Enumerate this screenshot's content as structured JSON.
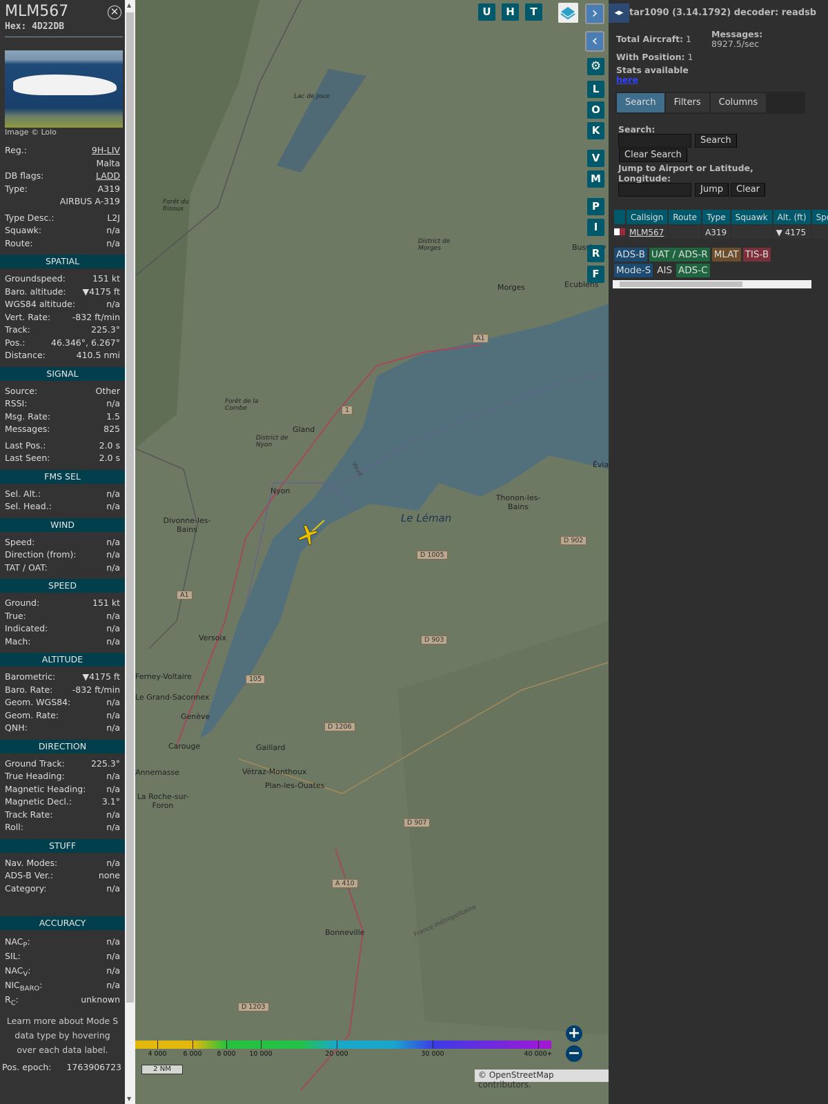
{
  "detail": {
    "callsign": "MLM567",
    "hex": "Hex: 4D22DB",
    "image_credit": "Image © Lolo",
    "top_rows": [
      {
        "label": "Reg.:",
        "value": "9H-LIV",
        "link": true
      },
      {
        "label": "",
        "value": "Malta"
      },
      {
        "label": "DB flags:",
        "value": "LADD",
        "link": true
      },
      {
        "label": "Type:",
        "value": "A319"
      },
      {
        "label": "",
        "value": "AIRBUS A-319"
      },
      {
        "label": "Type Desc.:",
        "value": "L2J"
      },
      {
        "label": "Squawk:",
        "value": "n/a"
      },
      {
        "label": "Route:",
        "value": "n/a"
      }
    ],
    "sections": [
      {
        "title": "SPATIAL",
        "rows": [
          [
            "Groundspeed:",
            "151 kt"
          ],
          [
            "Baro. altitude:",
            "▼4175 ft"
          ],
          [
            "WGS84 altitude:",
            "n/a"
          ],
          [
            "Vert. Rate:",
            "-832 ft/min"
          ],
          [
            "Track:",
            "225.3°"
          ],
          [
            "Pos.:",
            "46.346°, 6.267°"
          ],
          [
            "Distance:",
            "410.5 nmi"
          ]
        ]
      },
      {
        "title": "SIGNAL",
        "rows": [
          [
            "Source:",
            "Other"
          ],
          [
            "RSSI:",
            "n/a"
          ],
          [
            "Msg. Rate:",
            "1.5"
          ],
          [
            "Messages:",
            "825"
          ],
          [
            "Last Pos.:",
            "2.0 s"
          ],
          [
            "Last Seen:",
            "2.0 s"
          ]
        ]
      },
      {
        "title": "FMS SEL",
        "rows": [
          [
            "Sel. Alt.:",
            "n/a"
          ],
          [
            "Sel. Head.:",
            "n/a"
          ]
        ]
      },
      {
        "title": "WIND",
        "rows": [
          [
            "Speed:",
            "n/a"
          ],
          [
            "Direction (from):",
            "n/a"
          ],
          [
            "TAT / OAT:",
            "n/a"
          ]
        ]
      },
      {
        "title": "SPEED",
        "rows": [
          [
            "Ground:",
            "151 kt"
          ],
          [
            "True:",
            "n/a"
          ],
          [
            "Indicated:",
            "n/a"
          ],
          [
            "Mach:",
            "n/a"
          ]
        ]
      },
      {
        "title": "ALTITUDE",
        "rows": [
          [
            "Barometric:",
            "▼4175 ft"
          ],
          [
            "Baro. Rate:",
            "-832 ft/min"
          ],
          [
            "Geom. WGS84:",
            "n/a"
          ],
          [
            "Geom. Rate:",
            "n/a"
          ],
          [
            "QNH:",
            "n/a"
          ]
        ]
      },
      {
        "title": "DIRECTION",
        "rows": [
          [
            "Ground Track:",
            "225.3°"
          ],
          [
            "True Heading:",
            "n/a"
          ],
          [
            "Magnetic Heading:",
            "n/a"
          ],
          [
            "Magnetic Decl.:",
            "3.1°"
          ],
          [
            "Track Rate:",
            "n/a"
          ],
          [
            "Roll:",
            "n/a"
          ]
        ]
      },
      {
        "title": "STUFF",
        "rows": [
          [
            "Nav. Modes:",
            "n/a"
          ],
          [
            "ADS-B Ver.:",
            "none"
          ],
          [
            "Category:",
            "n/a"
          ]
        ]
      }
    ],
    "accuracy": {
      "title": "ACCURACY",
      "rows": [
        {
          "label": "NAC",
          "sub": "P",
          "value": "n/a"
        },
        {
          "label": "SIL",
          "sub": "",
          "value": "n/a"
        },
        {
          "label": "NAC",
          "sub": "V",
          "value": "n/a"
        },
        {
          "label": "NIC",
          "sub": "BARO",
          "value": "n/a"
        },
        {
          "label": "R",
          "sub": "C",
          "value": "unknown"
        }
      ]
    },
    "learn_more": "Learn more about Mode S data type by hovering over each data label.",
    "pos_epoch_label": "Pos. epoch:",
    "pos_epoch": "1763906723"
  },
  "map": {
    "top_buttons": [
      "U",
      "H",
      "T"
    ],
    "side_buttons": [
      "L",
      "O",
      "K",
      "V",
      "M",
      "P",
      "I",
      "R",
      "F"
    ],
    "places": [
      "Lac de Joux",
      "Forêt du Risoux",
      "District de Morges",
      "Morges",
      "Bussigny",
      "Ecublens",
      "Forêt de la Combe",
      "Gland",
      "District de Nyon",
      "Nyon",
      "Divonne-les-Bains",
      "Le Léman",
      "Thonon-les-Bains",
      "Évian",
      "Versoix",
      "Ferney-Voltaire",
      "Le Grand-Saconnex",
      "Genève",
      "Carouge",
      "Annemasse",
      "Gaillard",
      "Vétraz-Monthoux",
      "Plan-les-Ouates",
      "La Roche-sur-Foron",
      "Bonneville",
      "France métropolitaine",
      "Vaud"
    ],
    "roads": [
      "A1",
      "1",
      "D 1005",
      "D 902",
      "D 903",
      "105",
      "D 1206",
      "D 907",
      "A 410",
      "D 1203",
      "A1"
    ],
    "altitude_legend": [
      "4 000",
      "6 000",
      "8 000",
      "10 000",
      "20 000",
      "30 000",
      "40 000+"
    ],
    "scale": "2 NM",
    "attribution_prefix": "© ",
    "attribution_link": "OpenStreetMap",
    "attribution_suffix": " contributors."
  },
  "sidebar": {
    "version_link": "tar1090",
    "version": " (3.14.1792) decoder: ",
    "decoder": "readsb",
    "total_label": "Total Aircraft:",
    "total": " 1",
    "messages_label": "Messages:",
    "messages": "8927.5/sec",
    "with_pos_label": "With Position:",
    "with_pos": " 1",
    "stats_label": "Stats available",
    "stats_link": "here",
    "tabs": [
      "Search",
      "Filters",
      "Columns"
    ],
    "search_label": "Search:",
    "search_btn": "Search",
    "clear_search_btn": "Clear Search",
    "jump_label": "Jump to Airport or Latitude, Longitude:",
    "jump_btn": "Jump",
    "clear_btn": "Clear",
    "columns": [
      "",
      "Callsign",
      "Route",
      "Type",
      "Squawk",
      "Alt. (ft)",
      "Spd"
    ],
    "aircraft": [
      {
        "callsign": "MLM567",
        "route": "",
        "type": "A319",
        "squawk": "",
        "alt": "▼ 4175"
      }
    ],
    "badges": [
      {
        "label": "ADS-B",
        "color": "#1c4a70"
      },
      {
        "label": "UAT / ADS-R",
        "color": "#1f6640"
      },
      {
        "label": "MLAT",
        "color": "#6b4e2c"
      },
      {
        "label": "TIS-B",
        "color": "#7a2f3a"
      },
      {
        "label": "Mode-S",
        "color": "#1c4a70"
      },
      {
        "label": "AIS",
        "color": ""
      },
      {
        "label": "ADS-C",
        "color": "#1f6640"
      }
    ]
  }
}
